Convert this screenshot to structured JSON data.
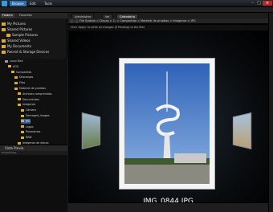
{
  "titlebar": {
    "tabs": [
      "Browse",
      "Edit",
      "Tools"
    ],
    "active": 0
  },
  "sidebar": {
    "tabs": [
      "Folders",
      "Favorites"
    ],
    "favorites": [
      "My Pictures",
      "Shared Pictures",
      "Sample Pictures",
      "Shared Videos",
      "My Documents",
      "Recent & Storage Devices"
    ],
    "tree": [
      {
        "label": "Local Disk",
        "level": 1
      },
      {
        "label": "ACD",
        "level": 2
      },
      {
        "label": "Compartido",
        "level": 3
      },
      {
        "label": "Descargas",
        "level": 4
      },
      {
        "label": "Files",
        "level": 4
      },
      {
        "label": "Material de pruebas",
        "level": 4
      },
      {
        "label": "Archivos comprimidos",
        "level": 5
      },
      {
        "label": "Documentos",
        "level": 5
      },
      {
        "label": "Imágenes",
        "level": 5
      },
      {
        "label": "Cámara",
        "level": 6
      },
      {
        "label": "Damaged_images",
        "level": 6
      },
      {
        "label": "JPG",
        "level": 6,
        "selected": true
      },
      {
        "label": "Logos",
        "level": 6
      },
      {
        "label": "Panoramas",
        "level": 6
      },
      {
        "label": "RAW",
        "level": 6
      },
      {
        "label": "Imágenes de discos",
        "level": 5
      },
      {
        "label": "Música",
        "level": 5
      },
      {
        "label": "Vídeo",
        "level": 5
      }
    ],
    "preview_title": "Vista Previa",
    "preview_sub": "Propiedades"
  },
  "main": {
    "tabs": [
      "Administrar",
      "Ver",
      "Calendario"
    ],
    "breadcrumb": "File System > Discos > C: > Compartido > Material de pruebas > Imágenes > JPG",
    "hint": "Click 'Apply' to write all changes (0 Pending) to the files",
    "caption": "IMG_0844.JPG"
  }
}
